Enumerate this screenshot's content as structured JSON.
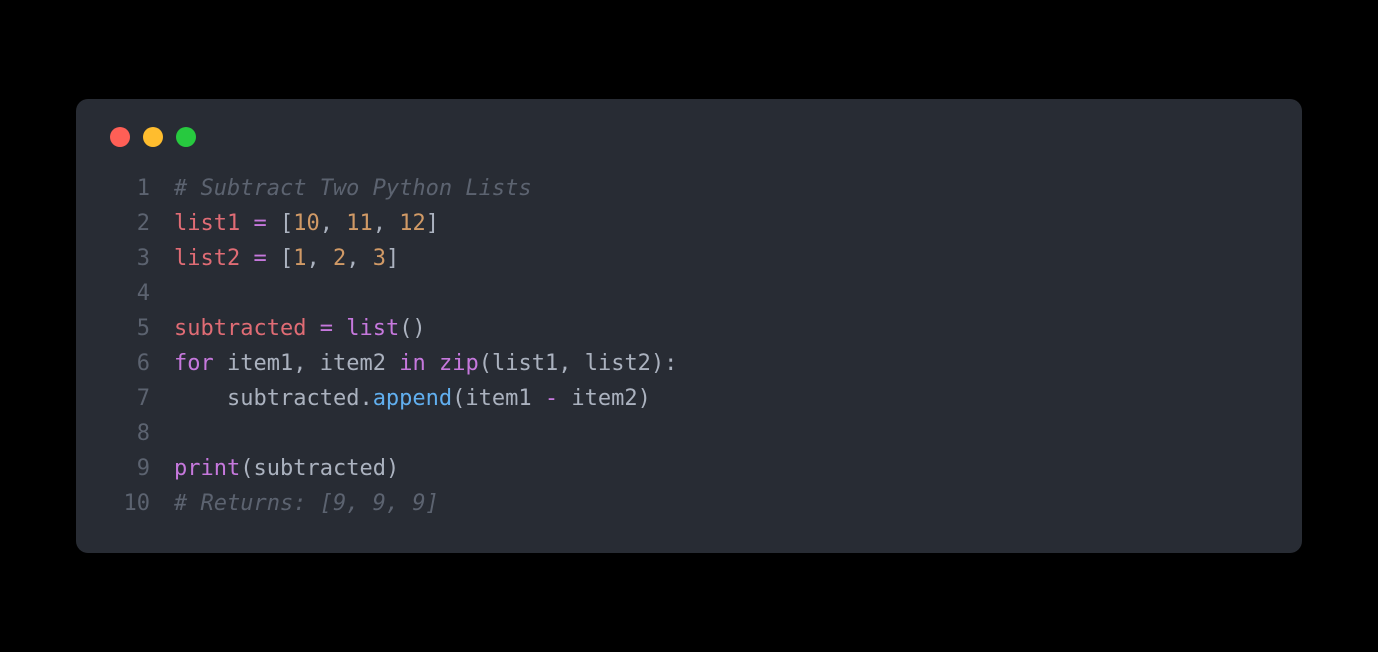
{
  "window": {
    "dots": [
      "close",
      "minimize",
      "maximize"
    ]
  },
  "code": {
    "lines": [
      {
        "num": "1",
        "tokens": [
          {
            "t": "# Subtract Two Python Lists",
            "c": "tok-comment"
          }
        ]
      },
      {
        "num": "2",
        "tokens": [
          {
            "t": "list1",
            "c": "tok-name"
          },
          {
            "t": " ",
            "c": ""
          },
          {
            "t": "=",
            "c": "tok-operator"
          },
          {
            "t": " ",
            "c": ""
          },
          {
            "t": "[",
            "c": "tok-punct"
          },
          {
            "t": "10",
            "c": "tok-number"
          },
          {
            "t": ", ",
            "c": "tok-punct"
          },
          {
            "t": "11",
            "c": "tok-number"
          },
          {
            "t": ", ",
            "c": "tok-punct"
          },
          {
            "t": "12",
            "c": "tok-number"
          },
          {
            "t": "]",
            "c": "tok-punct"
          }
        ]
      },
      {
        "num": "3",
        "tokens": [
          {
            "t": "list2",
            "c": "tok-name"
          },
          {
            "t": " ",
            "c": ""
          },
          {
            "t": "=",
            "c": "tok-operator"
          },
          {
            "t": " ",
            "c": ""
          },
          {
            "t": "[",
            "c": "tok-punct"
          },
          {
            "t": "1",
            "c": "tok-number"
          },
          {
            "t": ", ",
            "c": "tok-punct"
          },
          {
            "t": "2",
            "c": "tok-number"
          },
          {
            "t": ", ",
            "c": "tok-punct"
          },
          {
            "t": "3",
            "c": "tok-number"
          },
          {
            "t": "]",
            "c": "tok-punct"
          }
        ]
      },
      {
        "num": "4",
        "tokens": []
      },
      {
        "num": "5",
        "tokens": [
          {
            "t": "subtracted",
            "c": "tok-name"
          },
          {
            "t": " ",
            "c": ""
          },
          {
            "t": "=",
            "c": "tok-operator"
          },
          {
            "t": " ",
            "c": ""
          },
          {
            "t": "list",
            "c": "tok-func"
          },
          {
            "t": "()",
            "c": "tok-punct"
          }
        ]
      },
      {
        "num": "6",
        "tokens": [
          {
            "t": "for",
            "c": "tok-keyword"
          },
          {
            "t": " ",
            "c": ""
          },
          {
            "t": "item1",
            "c": "tok-def"
          },
          {
            "t": ", ",
            "c": "tok-punct"
          },
          {
            "t": "item2",
            "c": "tok-def"
          },
          {
            "t": " ",
            "c": ""
          },
          {
            "t": "in",
            "c": "tok-keyword"
          },
          {
            "t": " ",
            "c": ""
          },
          {
            "t": "zip",
            "c": "tok-func"
          },
          {
            "t": "(",
            "c": "tok-punct"
          },
          {
            "t": "list1",
            "c": "tok-def"
          },
          {
            "t": ", ",
            "c": "tok-punct"
          },
          {
            "t": "list2",
            "c": "tok-def"
          },
          {
            "t": "):",
            "c": "tok-punct"
          }
        ]
      },
      {
        "num": "7",
        "tokens": [
          {
            "t": "    ",
            "c": ""
          },
          {
            "t": "subtracted",
            "c": "tok-def"
          },
          {
            "t": ".",
            "c": "tok-punct"
          },
          {
            "t": "append",
            "c": "tok-method"
          },
          {
            "t": "(",
            "c": "tok-punct"
          },
          {
            "t": "item1",
            "c": "tok-def"
          },
          {
            "t": " ",
            "c": ""
          },
          {
            "t": "-",
            "c": "tok-operator"
          },
          {
            "t": " ",
            "c": ""
          },
          {
            "t": "item2",
            "c": "tok-def"
          },
          {
            "t": ")",
            "c": "tok-punct"
          }
        ]
      },
      {
        "num": "8",
        "tokens": []
      },
      {
        "num": "9",
        "tokens": [
          {
            "t": "print",
            "c": "tok-func"
          },
          {
            "t": "(",
            "c": "tok-punct"
          },
          {
            "t": "subtracted",
            "c": "tok-def"
          },
          {
            "t": ")",
            "c": "tok-punct"
          }
        ]
      },
      {
        "num": "10",
        "tokens": [
          {
            "t": "# Returns: [9, 9, 9]",
            "c": "tok-comment"
          }
        ]
      }
    ]
  }
}
